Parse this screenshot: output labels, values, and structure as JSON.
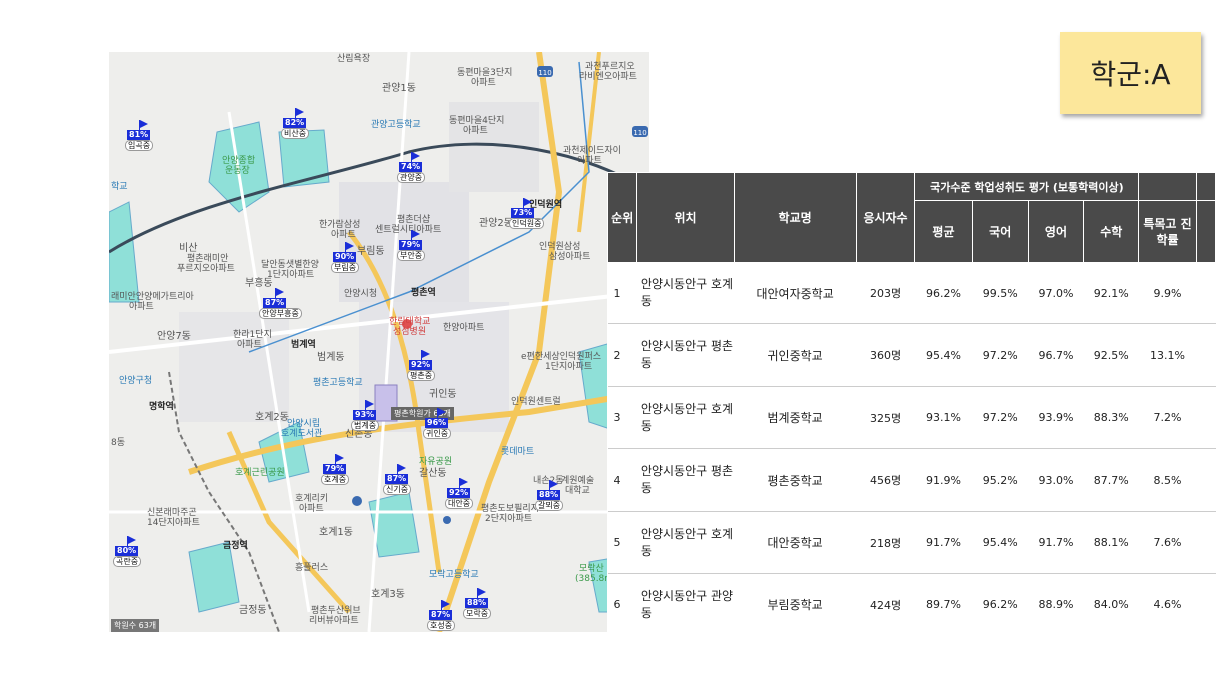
{
  "badge": {
    "label": "학군:A"
  },
  "map": {
    "schools": [
      {
        "pct": "81%",
        "name": "임곡중"
      },
      {
        "pct": "82%",
        "name": "비산중"
      },
      {
        "pct": "74%",
        "name": "관양중"
      },
      {
        "pct": "73%",
        "name": "인덕원중"
      },
      {
        "pct": "90%",
        "name": "부림중"
      },
      {
        "pct": "79%",
        "name": "부안중"
      },
      {
        "pct": "87%",
        "name": "안양부흥중"
      },
      {
        "pct": "92%",
        "name": "평촌중"
      },
      {
        "pct": "93%",
        "name": "범계중"
      },
      {
        "pct": "96%",
        "name": "귀인중"
      },
      {
        "pct": "79%",
        "name": "호계중"
      },
      {
        "pct": "87%",
        "name": "신기중"
      },
      {
        "pct": "92%",
        "name": "대안중"
      },
      {
        "pct": "88%",
        "name": "갈뫼중"
      },
      {
        "pct": "80%",
        "name": "곡란중"
      },
      {
        "pct": "87%",
        "name": "호성중"
      },
      {
        "pct": "88%",
        "name": "모락중"
      }
    ],
    "labels": {
      "sanrim": "산림욕장",
      "gwanyang1": "관양1동",
      "dongpyeon3": "동편마을3단지",
      "dongpyeon3b": "아파트",
      "dongpyeon4": "동편마을4단지",
      "dongpyeon4b": "아파트",
      "gwacheon_prugio": "과천푸르지오",
      "gwacheon_prugio_b": "라비엔오아파트",
      "gwanyang_hs": "관양고등학교",
      "gwacheon_j": "과천제이드자이",
      "gwacheon_j_b": "아파트",
      "anyang_sports": "안양종합",
      "anyang_sports_b": "운동장",
      "hakgyo": "학교",
      "hangaram": "한가람삼성",
      "hangaram_b": "아파트",
      "pyeongchon_dx": "평촌더샵",
      "pyeongchon_dx_b": "센트럴시티아파트",
      "gwanyang2": "관양2동",
      "induk_station": "인덕원역",
      "biksan": "비산",
      "pyeongchon_raemian": "평촌래미안",
      "pyeongchon_raemian_b": "푸르지오아파트",
      "dalan": "달안동샛별한양",
      "dalan_b": "1단지아파트",
      "burim": "부림동",
      "anyang_cityhall": "안양시청",
      "pyeongchon_station": "평촌역",
      "indukwon_park": "인덕원삼성",
      "indukwon_park_b": "삼성아파트",
      "buheung": "부흥동",
      "raemian_anyang": "래미안안양메가트리아",
      "raemian_anyang_b": "아파트",
      "hanra": "한라1단지",
      "hanra_b": "아파트",
      "beomgye_station": "범계역",
      "hallym": "한림대학교",
      "hallym_b": "성심병원",
      "hanyang_apt": "한양아파트",
      "anyang7": "안양7동",
      "beomgye_dong": "범계동",
      "pyeongchon_hs": "평촌고등학교",
      "e_pyeonhan": "e편한세상인덕원퍼스",
      "e_pyeonhan_b": "1단지아파트",
      "anyang_gu": "안양구청",
      "pyeongchon_hagwon": "평촌학원가 63개",
      "gwiin_dong": "귀인동",
      "indukwon_ipark": "인덕원센트럴",
      "myeonghak": "명학역",
      "hogye2": "호계2동",
      "anyang_lib": "안양시립",
      "anyang_lib_b": "호계도서관",
      "sinchon": "신촌동",
      "hogye_park": "호계근린공원",
      "jayu_park": "자유공원",
      "galsan": "갈산동",
      "hogye_rich": "호계리키",
      "hogye_rich_b": "아파트",
      "sinbun": "신본래마주곤",
      "sinbun_b": "14단지아파트",
      "pyeongchon_dobo": "평촌도보필리지",
      "pyeongchon_dobo_b": "2단지아파트",
      "hogye1": "호계1동",
      "geumjeong": "금정역",
      "heungplus": "흥플러스",
      "morak_hs": "모락고등학교",
      "morak_mt": "모락산",
      "morak_mt_b": "(385.8m)",
      "geumjeong_dong": "금정동",
      "hogye3": "호계3동",
      "pyeongchon_prugio": "평촌두산위브",
      "pyeongchon_prugio_b": "리버뷰아파트",
      "anyang8": "8동",
      "hagwon_count": "학원수 63개",
      "lotte": "롯데마트",
      "bus": "내손2동",
      "anyang_art": "계원예술",
      "anyang_art_b": "대학교"
    }
  },
  "table": {
    "group_header": "국가수준 학업성취도 평가 (보통학력이상)",
    "headers": {
      "rank": "순위",
      "location": "위치",
      "school": "학교명",
      "applicants": "응시자수",
      "avg": "평균",
      "korean": "국어",
      "english": "영어",
      "math": "수학",
      "special": "특목고 진학률"
    },
    "rows": [
      {
        "rank": "1",
        "location": "안양시동안구 호계동",
        "school": "대안여자중학교",
        "applicants": "203명",
        "avg": "96.2%",
        "korean": "99.5%",
        "english": "97.0%",
        "math": "92.1%",
        "special": "9.9%"
      },
      {
        "rank": "2",
        "location": "안양시동안구 평촌동",
        "school": "귀인중학교",
        "applicants": "360명",
        "avg": "95.4%",
        "korean": "97.2%",
        "english": "96.7%",
        "math": "92.5%",
        "special": "13.1%"
      },
      {
        "rank": "3",
        "location": "안양시동안구 호계동",
        "school": "범계중학교",
        "applicants": "325명",
        "avg": "93.1%",
        "korean": "97.2%",
        "english": "93.9%",
        "math": "88.3%",
        "special": "7.2%"
      },
      {
        "rank": "4",
        "location": "안양시동안구 평촌동",
        "school": "평촌중학교",
        "applicants": "456명",
        "avg": "91.9%",
        "korean": "95.2%",
        "english": "93.0%",
        "math": "87.7%",
        "special": "8.5%"
      },
      {
        "rank": "5",
        "location": "안양시동안구 호계동",
        "school": "대안중학교",
        "applicants": "218명",
        "avg": "91.7%",
        "korean": "95.4%",
        "english": "91.7%",
        "math": "88.1%",
        "special": "7.6%"
      },
      {
        "rank": "6",
        "location": "안양시동안구 관양동",
        "school": "부림중학교",
        "applicants": "424명",
        "avg": "89.7%",
        "korean": "96.2%",
        "english": "88.9%",
        "math": "84.0%",
        "special": "4.6%"
      }
    ]
  }
}
